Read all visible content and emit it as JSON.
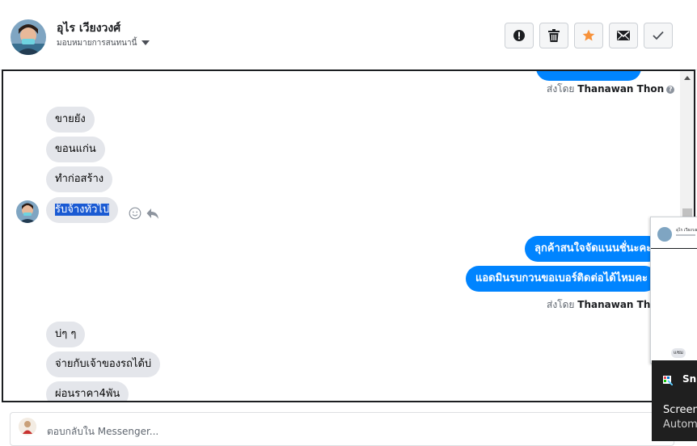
{
  "contact": {
    "name": "อุไร เวียงวงศ์",
    "status": "มอบหมายการสนทนานี้"
  },
  "actions": [
    {
      "name": "report-button",
      "icon": "exclamation-circle-icon"
    },
    {
      "name": "delete-button",
      "icon": "trash-icon"
    },
    {
      "name": "star-button",
      "icon": "star-icon"
    },
    {
      "name": "mark-unread-button",
      "icon": "envelope-icon"
    },
    {
      "name": "mark-done-button",
      "icon": "check-icon"
    }
  ],
  "messages": {
    "sender_prefix": "ส่งโดย",
    "sender_name_1": "Thanawan Thon",
    "sender_name_2": "Thanawan Thon",
    "in_1": "ขายยัง",
    "in_2": "ขอนแก่น",
    "in_3": "ทำก่อสร้าง",
    "in_4": "รับจ้างทั่วไป",
    "out_1": "ลุกค้าสนใจจัดแนนชั่นะคะ",
    "out_2": "แอดมินรบกวนขอเบอร์ติดต่อได้ไหมคะ",
    "in_5": "บ่ๆ ๆ",
    "in_6": "จ่ายกับเจ้าของรถได้บ่",
    "in_7": "ผ่อนราคา4พัน"
  },
  "reply": {
    "placeholder": "ตอบกลับใน Messenger..."
  },
  "preview": {
    "name": "อุไร เวียงวงศ์",
    "btn": "แชม"
  },
  "toast": {
    "title": "Sni",
    "line1": "Screen",
    "line2": "Autom"
  },
  "colors": {
    "accent": "#0084ff",
    "star": "#f7923b",
    "selection": "#1a5ad3"
  }
}
